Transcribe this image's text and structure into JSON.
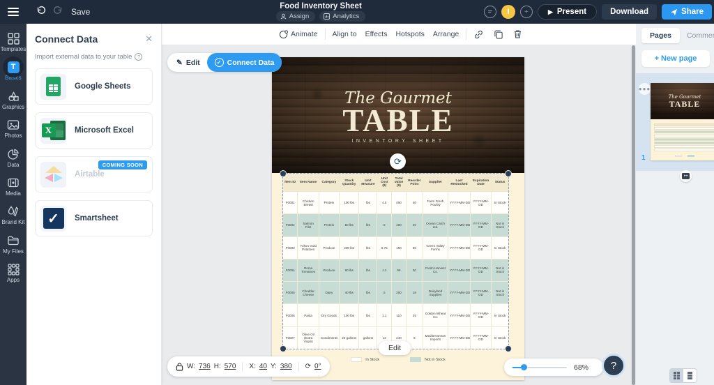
{
  "topbar": {
    "save": "Save",
    "title": "Food Inventory Sheet",
    "assign": "Assign",
    "analytics": "Analytics",
    "avatar_initial": "I",
    "present": "Present",
    "download": "Download",
    "share": "Share"
  },
  "sidebar": {
    "items": [
      {
        "label": "Templates"
      },
      {
        "label": "Basics",
        "active": true
      },
      {
        "label": "Graphics"
      },
      {
        "label": "Photos"
      },
      {
        "label": "Data"
      },
      {
        "label": "Media"
      },
      {
        "label": "Brand Kit"
      },
      {
        "label": "My Files"
      },
      {
        "label": "Apps"
      }
    ]
  },
  "connect_panel": {
    "title": "Connect Data",
    "subtitle": "Import external data to your table",
    "sources": [
      {
        "name": "Google Sheets"
      },
      {
        "name": "Microsoft Excel"
      },
      {
        "name": "Airtable",
        "badge": "COMING SOON",
        "disabled": true
      },
      {
        "name": "Smartsheet"
      }
    ]
  },
  "toolbar": {
    "animate": "Animate",
    "align_to": "Align to",
    "effects": "Effects",
    "hotspots": "Hotspots",
    "arrange": "Arrange"
  },
  "canvas": {
    "edit_button": "Edit",
    "connect_data_button": "Connect Data",
    "selection_edit_button": "Edit",
    "size_pill": {
      "w_label": "W:",
      "w": "736",
      "h_label": "H:",
      "h": "570",
      "x_label": "X:",
      "x": "40",
      "y_label": "Y:",
      "y": "380",
      "rotation": "0°"
    },
    "zoom_percent": "68%",
    "help": "?"
  },
  "design": {
    "title_script": "The Gourmet",
    "title_main": "TABLE",
    "subtitle": "INVENTORY SHEET",
    "legend": [
      {
        "label": "In Stock",
        "color": "#ffffff"
      },
      {
        "label": "Not in Stock",
        "color": "#c6dcd4"
      }
    ],
    "table": {
      "headers": [
        "Item ID",
        "Item Name",
        "Category",
        "Stock Quantity",
        "Unit Measure",
        "Unit Cost ($)",
        "Total Value ($)",
        "Reorder Point",
        "Supplier",
        "Last Restocked",
        "Expiration Date",
        "Status"
      ],
      "rows": [
        [
          "F0001",
          "Chicken Breast",
          "Protein",
          "100 lbs",
          "lbs",
          "4.5",
          "450",
          "40",
          "Farm Fresh Poultry",
          "YYYY-MM-DD",
          "YYYY-MM-DD",
          "In Stock"
        ],
        [
          "F0002",
          "Salmon Filet",
          "Protein",
          "50 lbs",
          "lbs",
          "8",
          "400",
          "20",
          "Ocean Catch Ltd.",
          "YYYY-MM-DD",
          "YYYY-MM-DD",
          "Not in Stock"
        ],
        [
          "F0003",
          "Yukon Gold Potatoes",
          "Produce",
          "200 lbs",
          "lbs",
          "0.75",
          "150",
          "60",
          "Green Valley Farms",
          "YYYY-MM-DD",
          "YYYY-MM-DD",
          "In Stock"
        ],
        [
          "F0004",
          "Roma Tomatoes",
          "Produce",
          "80 lbs",
          "lbs",
          "1.2",
          "96",
          "30",
          "Fresh Harvest Co.",
          "YYYY-MM-DD",
          "YYYY-MM-DD",
          "Not in Stock"
        ],
        [
          "F0005",
          "Cheddar Cheese",
          "Dairy",
          "40 lbs",
          "lbs",
          "5",
          "200",
          "18",
          "Dairyland Supplies",
          "YYYY-MM-DD",
          "YYYY-MM-DD",
          "Not in Stock"
        ],
        [
          "F0006",
          "Pasta",
          "Dry Goods",
          "100 lbs",
          "lbs",
          "1.1",
          "110",
          "25",
          "Golden Wheat Co.",
          "YYYY-MM-DD",
          "YYYY-MM-DD",
          "In Stock"
        ],
        [
          "F0007",
          "Olive Oil (Extra Virgin)",
          "Condiments",
          "20 gallons",
          "gallons",
          "12",
          "240",
          "5",
          "Mediterranean Imports",
          "YYYY-MM-DD",
          "YYYY-MM-DD",
          "In Stock"
        ]
      ]
    }
  },
  "pages_panel": {
    "tab_pages": "Pages",
    "tab_comments": "Comments",
    "new_page": "+ New page",
    "page_number": "1"
  },
  "colors": {
    "accent_blue": "#2e9bf0",
    "topbar_bg": "#1f2b3a",
    "teal_row": "#c6dcd4",
    "cream_bg": "#fcf3da"
  }
}
